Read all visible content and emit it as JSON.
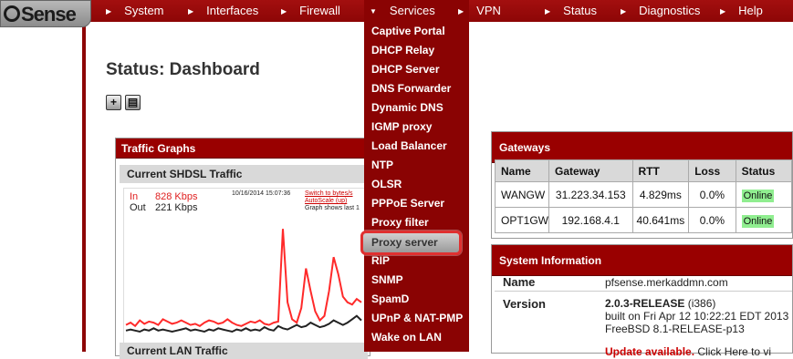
{
  "brand": {
    "logo_text": "Sense"
  },
  "nav": {
    "items": [
      {
        "label": "System"
      },
      {
        "label": "Interfaces"
      },
      {
        "label": "Firewall"
      },
      {
        "label": "Services"
      },
      {
        "label": "VPN"
      },
      {
        "label": "Status"
      },
      {
        "label": "Diagnostics"
      },
      {
        "label": "Help"
      }
    ],
    "active": "Services"
  },
  "page": {
    "title": "Status: Dashboard"
  },
  "toolbar": {
    "add_widget_icon": "plus-icon",
    "save_icon": "disk-icon"
  },
  "traffic": {
    "panel_title": "Traffic Graphs",
    "graph1_title": "Current SHDSL Traffic",
    "in_label": "In",
    "in_value": "828 Kbps",
    "out_label": "Out",
    "out_value": "221 Kbps",
    "date": "10/16/2014 15:07:36",
    "switch_link": "Switch to bytes/s",
    "autoscale_link": "AutoScale (up)",
    "note": "Graph shows last 1",
    "in_series": [
      10,
      12,
      9,
      14,
      11,
      13,
      12,
      10,
      15,
      13,
      11,
      12,
      14,
      12,
      10,
      11,
      9,
      12,
      14,
      13,
      11,
      12,
      15,
      12,
      10,
      9,
      11,
      13,
      12,
      14,
      11,
      10,
      12,
      13,
      95,
      30,
      15,
      12,
      25,
      60,
      40,
      22,
      14,
      18,
      40,
      70,
      55,
      35,
      30,
      28,
      33,
      30
    ],
    "out_series": [
      5,
      6,
      5,
      4,
      6,
      5,
      7,
      5,
      6,
      5,
      4,
      5,
      6,
      7,
      5,
      6,
      5,
      4,
      6,
      5,
      7,
      6,
      5,
      4,
      6,
      5,
      7,
      5,
      6,
      5,
      8,
      6,
      5,
      9,
      7,
      6,
      8,
      10,
      8,
      9,
      12,
      10,
      8,
      9,
      11,
      14,
      12,
      10,
      12,
      15,
      18,
      14
    ],
    "graph2_title": "Current LAN Traffic"
  },
  "services_menu": {
    "items": [
      "Captive Portal",
      "DHCP Relay",
      "DHCP Server",
      "DNS Forwarder",
      "Dynamic DNS",
      "IGMP proxy",
      "Load Balancer",
      "NTP",
      "OLSR",
      "PPPoE Server",
      "Proxy filter",
      "Proxy server",
      "RIP",
      "SNMP",
      "SpamD",
      "UPnP & NAT-PMP",
      "Wake on LAN"
    ],
    "selected": "Proxy server"
  },
  "gateways": {
    "title": "Gateways",
    "columns": [
      "Name",
      "Gateway",
      "RTT",
      "Loss",
      "Status"
    ],
    "rows": [
      [
        "WANGW",
        "31.223.34.153",
        "4.829ms",
        "0.0%",
        "Online"
      ],
      [
        "OPT1GW",
        "192.168.4.1",
        "40.641ms",
        "0.0%",
        "Online"
      ]
    ],
    "status_color": "#90ee90"
  },
  "system_info": {
    "title": "System Information",
    "name_label": "Name",
    "name_value": "pfsense.merkaddmn.com",
    "version_label": "Version",
    "version_main": "2.0.3-RELEASE",
    "version_arch": "(i386)",
    "version_built": "built on Fri Apr 12 10:22:21 EDT 2013",
    "version_os": "FreeBSD 8.1-RELEASE-p13",
    "update_text": "Update available.",
    "update_rest": "Click Here to vi"
  },
  "colors": {
    "brand_red": "#990000",
    "menu_red": "#8a0303",
    "highlight": "#e03030"
  }
}
